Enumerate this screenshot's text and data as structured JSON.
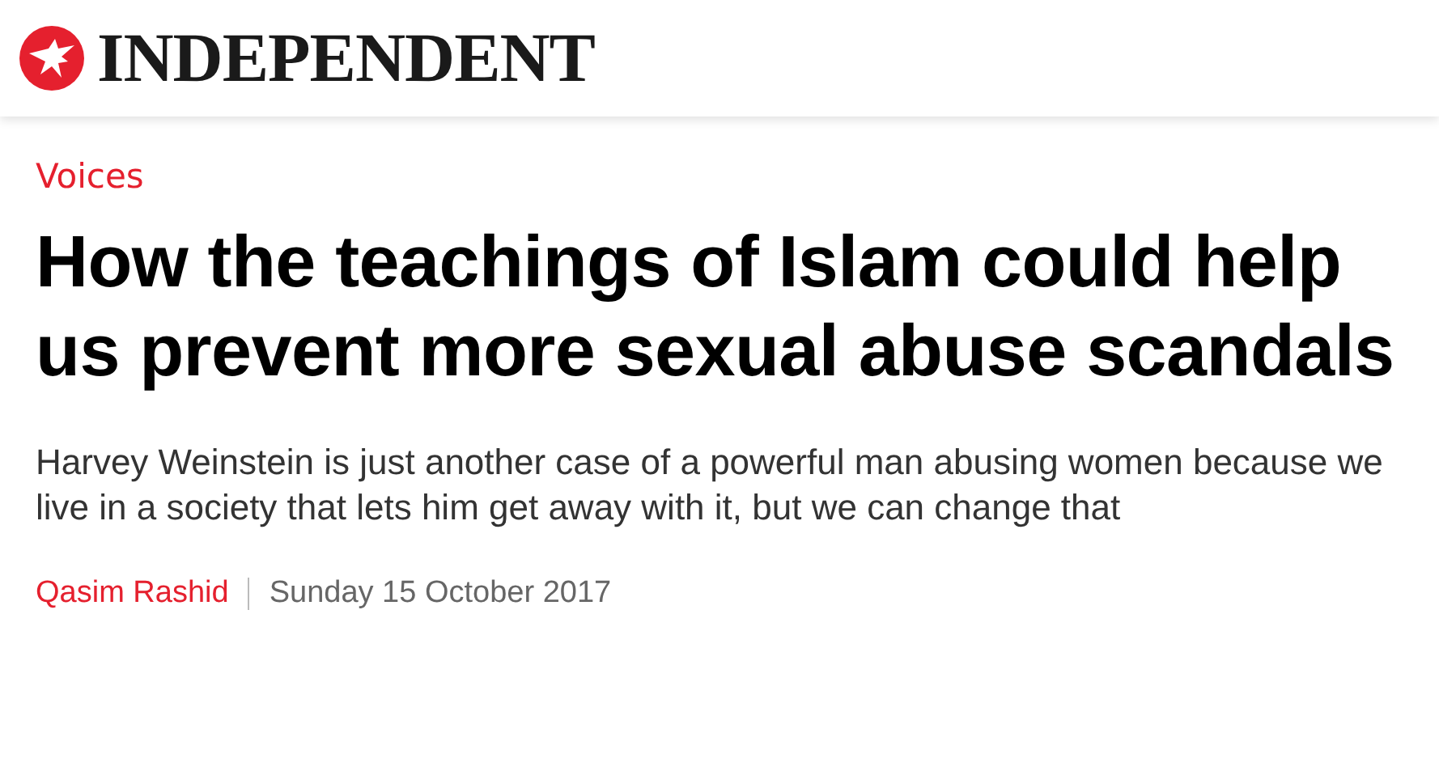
{
  "header": {
    "logo_text": "INDEPENDENT"
  },
  "article": {
    "section": "Voices",
    "headline": "How the teachings of Islam could help us prevent more sexual abuse scandals",
    "standfirst": "Harvey Weinstein is just another case of a powerful man abusing women because we live in a society that lets him get away with it, but we can change that",
    "author": "Qasim Rashid",
    "date": "Sunday 15 October 2017"
  }
}
